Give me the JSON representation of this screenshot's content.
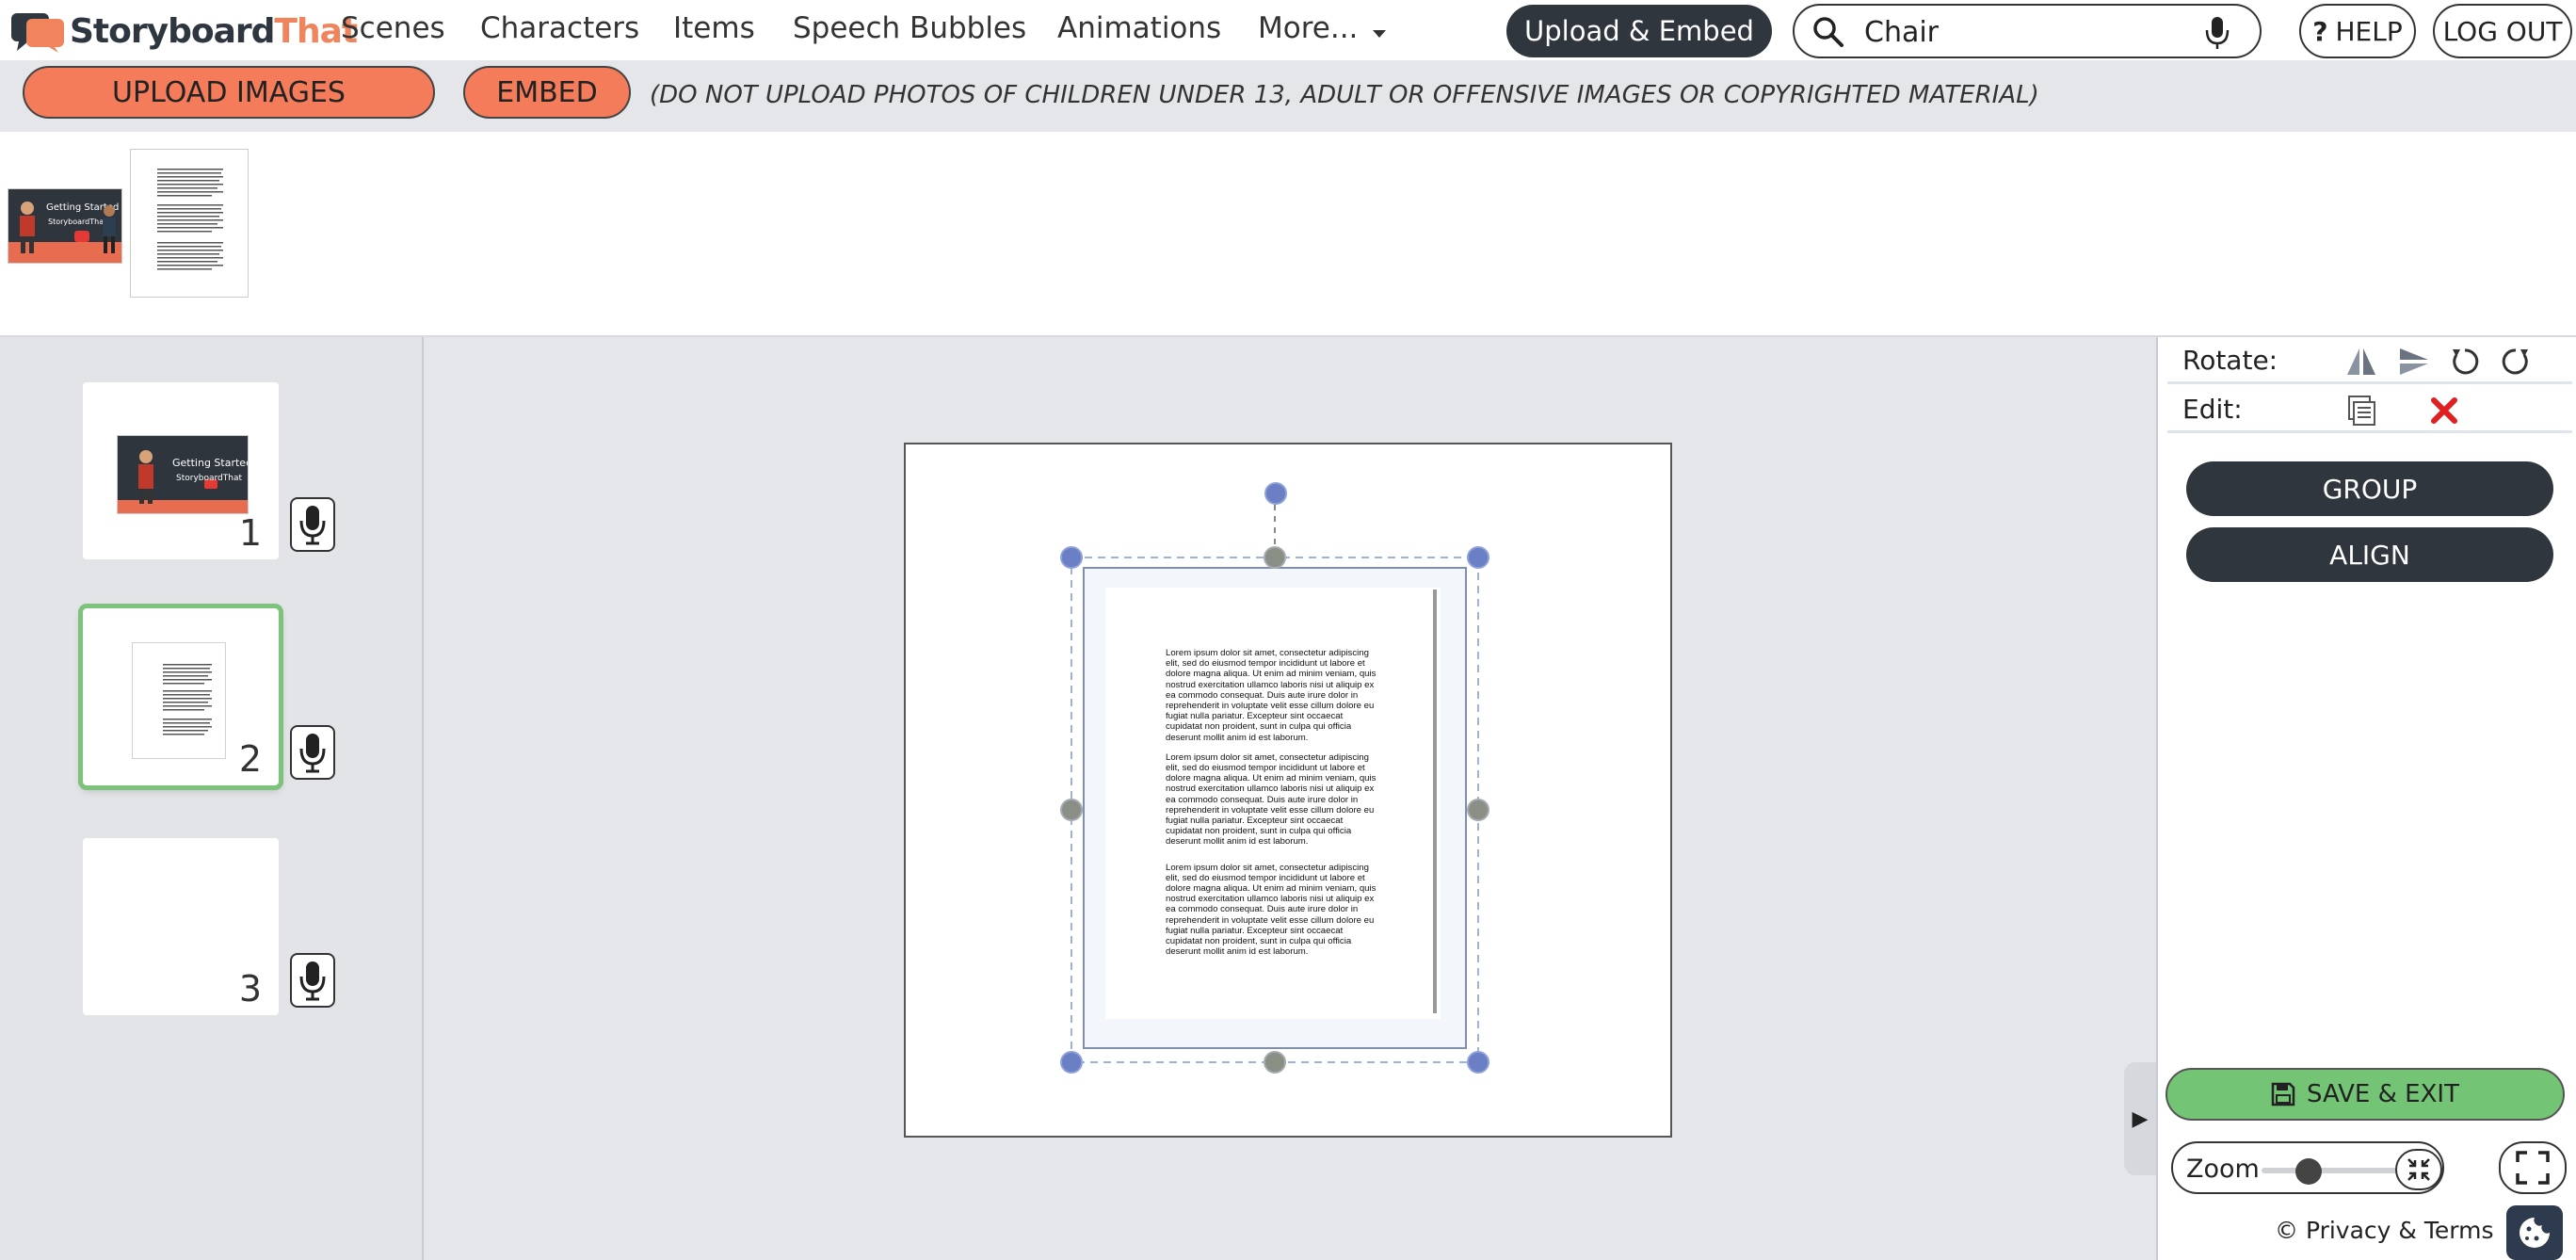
{
  "app": {
    "logo_primary": "Storyboard",
    "logo_accent": "That"
  },
  "nav": {
    "items": [
      "Scenes",
      "Characters",
      "Items",
      "Speech Bubbles",
      "Animations",
      "More..."
    ],
    "upload_embed": "Upload & Embed",
    "search_value": "Chair",
    "help": "HELP",
    "help_prefix": "?",
    "logout": "LOG OUT"
  },
  "upload": {
    "upload_images": "UPLOAD IMAGES",
    "embed": "EMBED",
    "warning": "(DO NOT UPLOAD PHOTOS OF CHILDREN UNDER 13, ADULT OR OFFENSIVE IMAGES OR COPYRIGHTED MATERIAL)"
  },
  "thumbnails": {
    "video_title": "Getting Started",
    "video_brand": "StoryboardThat"
  },
  "cells": [
    {
      "number": "1",
      "selected": false
    },
    {
      "number": "2",
      "selected": true
    },
    {
      "number": "3",
      "selected": false
    }
  ],
  "document": {
    "paragraphs": [
      "Lorem ipsum dolor sit amet, consectetur adipiscing elit, sed do eiusmod tempor incididunt ut labore et dolore magna aliqua. Ut enim ad minim veniam, quis nostrud exercitation ullamco laboris nisi ut aliquip ex ea commodo consequat. Duis aute irure dolor in reprehenderit in voluptate velit esse cillum dolore eu fugiat nulla pariatur. Excepteur sint occaecat cupidatat non proident, sunt in culpa qui officia deserunt mollit anim id est laborum.",
      "Lorem ipsum dolor sit amet, consectetur adipiscing elit, sed do eiusmod tempor incididunt ut labore et dolore magna aliqua. Ut enim ad minim veniam, quis nostrud exercitation ullamco laboris nisi ut aliquip ex ea commodo consequat. Duis aute irure dolor in reprehenderit in voluptate velit esse cillum dolore eu fugiat nulla pariatur. Excepteur sint occaecat cupidatat non proident, sunt in culpa qui officia deserunt mollit anim id est laborum.",
      "Lorem ipsum dolor sit amet, consectetur adipiscing elit, sed do eiusmod tempor incididunt ut labore et dolore magna aliqua. Ut enim ad minim veniam, quis nostrud exercitation ullamco laboris nisi ut aliquip ex ea commodo consequat. Duis aute irure dolor in reprehenderit in voluptate velit esse cillum dolore eu fugiat nulla pariatur. Excepteur sint occaecat cupidatat non proident, sunt in culpa qui officia deserunt mollit anim id est laborum."
    ]
  },
  "right_panel": {
    "rotate_label": "Rotate:",
    "edit_label": "Edit:",
    "group": "GROUP",
    "align": "ALIGN",
    "save_exit": "SAVE & EXIT",
    "zoom_label": "Zoom",
    "zoom_level": 0.3,
    "privacy": "© Privacy & Terms"
  },
  "colors": {
    "accent_orange": "#f47c5a",
    "dark_pill": "#30363d",
    "save_green": "#74c476",
    "handle_blue": "#6a7fc4",
    "delete_red": "#e02020"
  }
}
